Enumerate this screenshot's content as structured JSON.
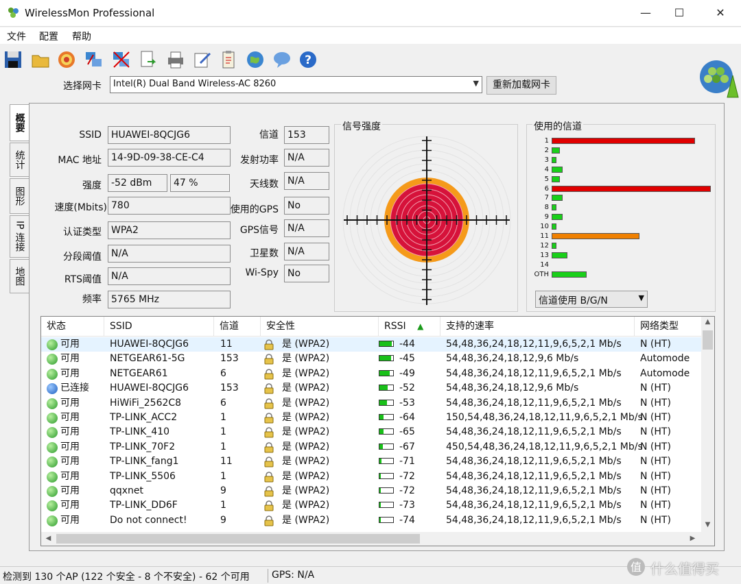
{
  "window": {
    "title": "WirelessMon Professional",
    "minimize": "—",
    "maximize": "☐",
    "close": "✕"
  },
  "menu": [
    "文件",
    "配置",
    "帮助"
  ],
  "toolbar": [
    "save-icon",
    "open-folder-icon",
    "target-icon",
    "network-cards-icon",
    "disconnect-icon",
    "export-icon",
    "print-icon",
    "edit-icon",
    "clipboard-icon",
    "globe-icon",
    "chat-icon",
    "help-icon"
  ],
  "adapter": {
    "label": "选择网卡",
    "value": "Intel(R) Dual Band Wireless-AC 8260",
    "reload": "重新加载网卡"
  },
  "tabs": [
    "概要",
    "统计",
    "图形",
    "IP 连接",
    "地图"
  ],
  "summary": {
    "ssid_label": "SSID",
    "ssid": "HUAWEI-8QCJG6",
    "mac_label": "MAC 地址",
    "mac": "14-9D-09-38-CE-C4",
    "strength_label": "强度",
    "strength_dbm": "-52 dBm",
    "strength_pct": "47 %",
    "speed_label": "速度(Mbits)",
    "speed": "780",
    "auth_label": "认证类型",
    "auth": "WPA2",
    "frag_label": "分段阈值",
    "frag": "N/A",
    "rts_label": "RTS阈值",
    "rts": "N/A",
    "freq_label": "频率",
    "freq": "5765 MHz",
    "channel_label": "信道",
    "channel": "153",
    "txpower_label": "发射功率",
    "txpower": "N/A",
    "antenna_label": "天线数",
    "antenna": "N/A",
    "gps_used_label": "使用的GPS",
    "gps_used": "No",
    "gps_signal_label": "GPS信号",
    "gps_signal": "N/A",
    "satellites_label": "卫星数",
    "satellites": "N/A",
    "wispy_label": "Wi-Spy",
    "wispy": "No"
  },
  "signal": {
    "title": "信号强度",
    "level_pct": 47
  },
  "channels": {
    "title": "使用的信道",
    "select": "信道使用 B/G/N",
    "rows": [
      {
        "label": "1",
        "value": 0.9,
        "color": "#e00000"
      },
      {
        "label": "2",
        "value": 0.05,
        "color": "#19d019"
      },
      {
        "label": "3",
        "value": 0.03,
        "color": "#19d019"
      },
      {
        "label": "4",
        "value": 0.07,
        "color": "#19d019"
      },
      {
        "label": "5",
        "value": 0.05,
        "color": "#19d019"
      },
      {
        "label": "6",
        "value": 1.0,
        "color": "#e00000"
      },
      {
        "label": "7",
        "value": 0.07,
        "color": "#19d019"
      },
      {
        "label": "8",
        "value": 0.03,
        "color": "#19d019"
      },
      {
        "label": "9",
        "value": 0.07,
        "color": "#19d019"
      },
      {
        "label": "10",
        "value": 0.03,
        "color": "#19d019"
      },
      {
        "label": "11",
        "value": 0.55,
        "color": "#f08000"
      },
      {
        "label": "12",
        "value": 0.03,
        "color": "#19d019"
      },
      {
        "label": "13",
        "value": 0.1,
        "color": "#19d019"
      },
      {
        "label": "14",
        "value": 0,
        "color": "#19d019"
      },
      {
        "label": "OTH",
        "value": 0.22,
        "color": "#19d019"
      }
    ]
  },
  "list": {
    "headers": [
      "状态",
      "SSID",
      "信道",
      "安全性",
      "RSSI",
      "支持的速率",
      "网络类型"
    ],
    "rows": [
      {
        "status": "可用",
        "connected": false,
        "ssid": "HUAWEI-8QCJG6",
        "channel": "11",
        "security": "是 (WPA2)",
        "rssi": "-44",
        "rssi_level": 0.9,
        "rates": "54,48,36,24,18,12,11,9,6,5,2,1 Mb/s",
        "type": "N (HT)"
      },
      {
        "status": "可用",
        "connected": false,
        "ssid": "NETGEAR61-5G",
        "channel": "153",
        "security": "是 (WPA2)",
        "rssi": "-45",
        "rssi_level": 0.85,
        "rates": "54,48,36,24,18,12,9,6 Mb/s",
        "type": "Automode"
      },
      {
        "status": "可用",
        "connected": false,
        "ssid": "NETGEAR61",
        "channel": "6",
        "security": "是 (WPA2)",
        "rssi": "-49",
        "rssi_level": 0.75,
        "rates": "54,48,36,24,18,12,11,9,6,5,2,1 Mb/s",
        "type": "Automode"
      },
      {
        "status": "已连接",
        "connected": true,
        "ssid": "HUAWEI-8QCJG6",
        "channel": "153",
        "security": "是 (WPA2)",
        "rssi": "-52",
        "rssi_level": 0.6,
        "rates": "54,48,36,24,18,12,9,6 Mb/s",
        "type": "N (HT)"
      },
      {
        "status": "可用",
        "connected": false,
        "ssid": "HiWiFi_2562C8",
        "channel": "6",
        "security": "是 (WPA2)",
        "rssi": "-53",
        "rssi_level": 0.55,
        "rates": "54,48,36,24,18,12,11,9,6,5,2,1 Mb/s",
        "type": "N (HT)"
      },
      {
        "status": "可用",
        "connected": false,
        "ssid": "TP-LINK_ACC2",
        "channel": "1",
        "security": "是 (WPA2)",
        "rssi": "-64",
        "rssi_level": 0.3,
        "rates": "150,54,48,36,24,18,12,11,9,6,5,2,1 Mb/s",
        "type": "N (HT)"
      },
      {
        "status": "可用",
        "connected": false,
        "ssid": "TP-LINK_410",
        "channel": "1",
        "security": "是 (WPA2)",
        "rssi": "-65",
        "rssi_level": 0.28,
        "rates": "54,48,36,24,18,12,11,9,6,5,2,1 Mb/s",
        "type": "N (HT)"
      },
      {
        "status": "可用",
        "connected": false,
        "ssid": "TP-LINK_70F2",
        "channel": "1",
        "security": "是 (WPA2)",
        "rssi": "-67",
        "rssi_level": 0.25,
        "rates": "450,54,48,36,24,18,12,11,9,6,5,2,1 Mb/s",
        "type": "N (HT)"
      },
      {
        "status": "可用",
        "connected": false,
        "ssid": "TP-LINK_fang1",
        "channel": "11",
        "security": "是 (WPA2)",
        "rssi": "-71",
        "rssi_level": 0.15,
        "rates": "54,48,36,24,18,12,11,9,6,5,2,1 Mb/s",
        "type": "N (HT)"
      },
      {
        "status": "可用",
        "connected": false,
        "ssid": "TP-LINK_5506",
        "channel": "1",
        "security": "是 (WPA2)",
        "rssi": "-72",
        "rssi_level": 0.12,
        "rates": "54,48,36,24,18,12,11,9,6,5,2,1 Mb/s",
        "type": "N (HT)"
      },
      {
        "status": "可用",
        "connected": false,
        "ssid": "qqxnet",
        "channel": "9",
        "security": "是 (WPA2)",
        "rssi": "-72",
        "rssi_level": 0.12,
        "rates": "54,48,36,24,18,12,11,9,6,5,2,1 Mb/s",
        "type": "N (HT)"
      },
      {
        "status": "可用",
        "connected": false,
        "ssid": "TP-LINK_DD6F",
        "channel": "1",
        "security": "是 (WPA2)",
        "rssi": "-73",
        "rssi_level": 0.1,
        "rates": "54,48,36,24,18,12,11,9,6,5,2,1 Mb/s",
        "type": "N (HT)"
      },
      {
        "status": "可用",
        "connected": false,
        "ssid": "Do not connect!",
        "channel": "9",
        "security": "是 (WPA2)",
        "rssi": "-74",
        "rssi_level": 0.1,
        "rates": "54,48,36,24,18,12,11,9,6,5,2,1 Mb/s",
        "type": "N (HT)"
      }
    ]
  },
  "status": {
    "text": "检测到 130 个AP (122 个安全 - 8 个不安全) - 62 个可用",
    "gps": "GPS: N/A"
  },
  "watermark": "什么值得买"
}
